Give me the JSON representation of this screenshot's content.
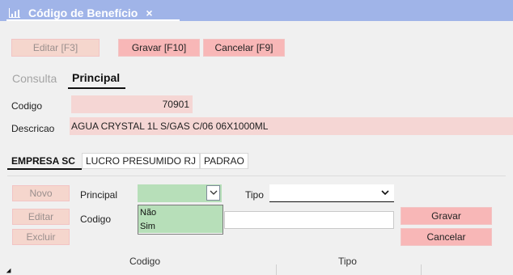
{
  "window": {
    "tab_title": "Código de Benefício",
    "tab_close": "×"
  },
  "toolbar": {
    "edit_label": "Editar [F3]",
    "save_label": "Gravar [F10]",
    "cancel_label": "Cancelar [F9]"
  },
  "subtabs": {
    "consulta": "Consulta",
    "principal": "Principal"
  },
  "form": {
    "codigo_label": "Codigo",
    "codigo_value": "70901",
    "descricao_label": "Descricao",
    "descricao_value": "AGUA CRYSTAL 1L S/GAS C/06 06X1000ML"
  },
  "company_tabs": [
    "EMPRESA SC",
    "LUCRO PRESUMIDO RJ",
    "PADRAO"
  ],
  "detail": {
    "novo_label": "Novo",
    "editar_label": "Editar",
    "excluir_label": "Excluir",
    "principal_label": "Principal",
    "tipo_label": "Tipo",
    "codigo_label": "Codigo",
    "principal_options": [
      "Não",
      "Sim"
    ],
    "gravar_label": "Gravar",
    "cancelar_label": "Cancelar"
  },
  "grid": {
    "columns": [
      "Codigo",
      "Tipo"
    ]
  },
  "colors": {
    "titlebar": "#a0b4e8",
    "button_enabled": "#f8b7b7",
    "button_disabled": "#f5d6cd",
    "field_bg": "#f5d6d4",
    "select_green": "#b7dfb9"
  }
}
